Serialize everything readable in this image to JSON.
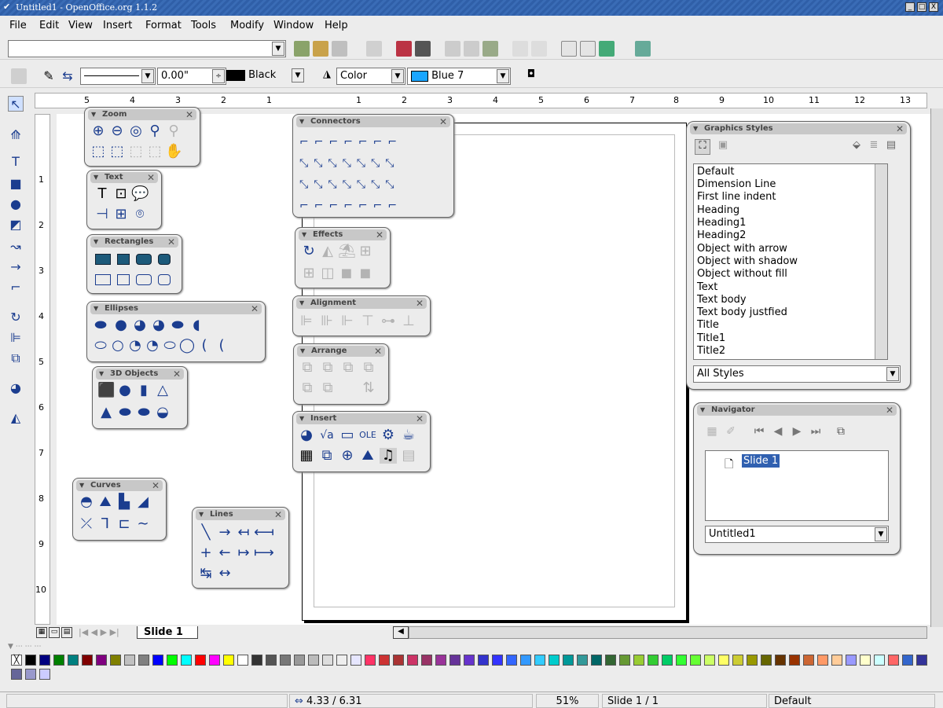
{
  "app": {
    "title": "Untitled1 - OpenOffice.org 1.1.2",
    "window_buttons": [
      "_",
      "□",
      "X"
    ]
  },
  "menu": [
    "File",
    "Edit",
    "View",
    "Insert",
    "Format",
    "Tools",
    "Modify",
    "Window",
    "Help"
  ],
  "line_toolbar": {
    "width_value": "0.00\"",
    "line_color": "Black",
    "area_style": "Color",
    "area_color": "Blue 7"
  },
  "rulers": {
    "h_labels": [
      "5",
      "4",
      "3",
      "2",
      "1",
      "1",
      "2",
      "3",
      "4",
      "5",
      "6",
      "7",
      "8",
      "9",
      "10",
      "11",
      "12",
      "13"
    ],
    "v_labels": [
      "1",
      "2",
      "3",
      "4",
      "5",
      "6",
      "7",
      "8",
      "9",
      "10"
    ]
  },
  "palettes": {
    "zoom": "Zoom",
    "text": "Text",
    "rectangles": "Rectangles",
    "ellipses": "Ellipses",
    "objects3d": "3D Objects",
    "curves": "Curves",
    "lines": "Lines",
    "connectors": "Connectors",
    "effects": "Effects",
    "alignment": "Alignment",
    "arrange": "Arrange",
    "insert": "Insert"
  },
  "graphics_styles": {
    "title": "Graphics Styles",
    "items": [
      "Default",
      "Dimension Line",
      "First line indent",
      "Heading",
      "Heading1",
      "Heading2",
      "Object with arrow",
      "Object with shadow",
      "Object without fill",
      "Text",
      "Text body",
      "Text body justfied",
      "Title",
      "Title1",
      "Title2"
    ],
    "filter": "All Styles"
  },
  "navigator": {
    "title": "Navigator",
    "item": "Slide 1",
    "document": "Untitled1"
  },
  "tabs": {
    "active": "Slide 1"
  },
  "colors": [
    "#000000",
    "#000080",
    "#008000",
    "#008080",
    "#800000",
    "#800080",
    "#808000",
    "#c0c0c0",
    "#808080",
    "#0000ff",
    "#00ff00",
    "#00ffff",
    "#ff0000",
    "#ff00ff",
    "#ffff00",
    "#ffffff",
    "#333333",
    "#555555",
    "#777777",
    "#999999",
    "#bbbbbb",
    "#dddddd",
    "#eeeeee",
    "#e6e6ff",
    "#ff3366",
    "#cc3333",
    "#aa3333",
    "#cc3366",
    "#993366",
    "#993399",
    "#663399",
    "#6633cc",
    "#3333cc",
    "#3333ff",
    "#3366ff",
    "#3399ff",
    "#33ccff",
    "#00cccc",
    "#009999",
    "#339999",
    "#006666",
    "#336633",
    "#669933",
    "#99cc33",
    "#33cc33",
    "#00cc66",
    "#33ff33",
    "#66ff33",
    "#ccff66",
    "#ffff66",
    "#cccc33",
    "#999900",
    "#666600",
    "#663300",
    "#993300",
    "#cc6633",
    "#ff9966",
    "#ffcc99",
    "#9999ff",
    "#ffffcc",
    "#ccffff",
    "#ff6666",
    "#3366cc",
    "#333399",
    "#666699",
    "#9999cc",
    "#ccccff"
  ],
  "status": {
    "coords": "4.33 / 6.31",
    "zoom": "51%",
    "slide": "Slide 1 / 1",
    "layout": "Default"
  }
}
